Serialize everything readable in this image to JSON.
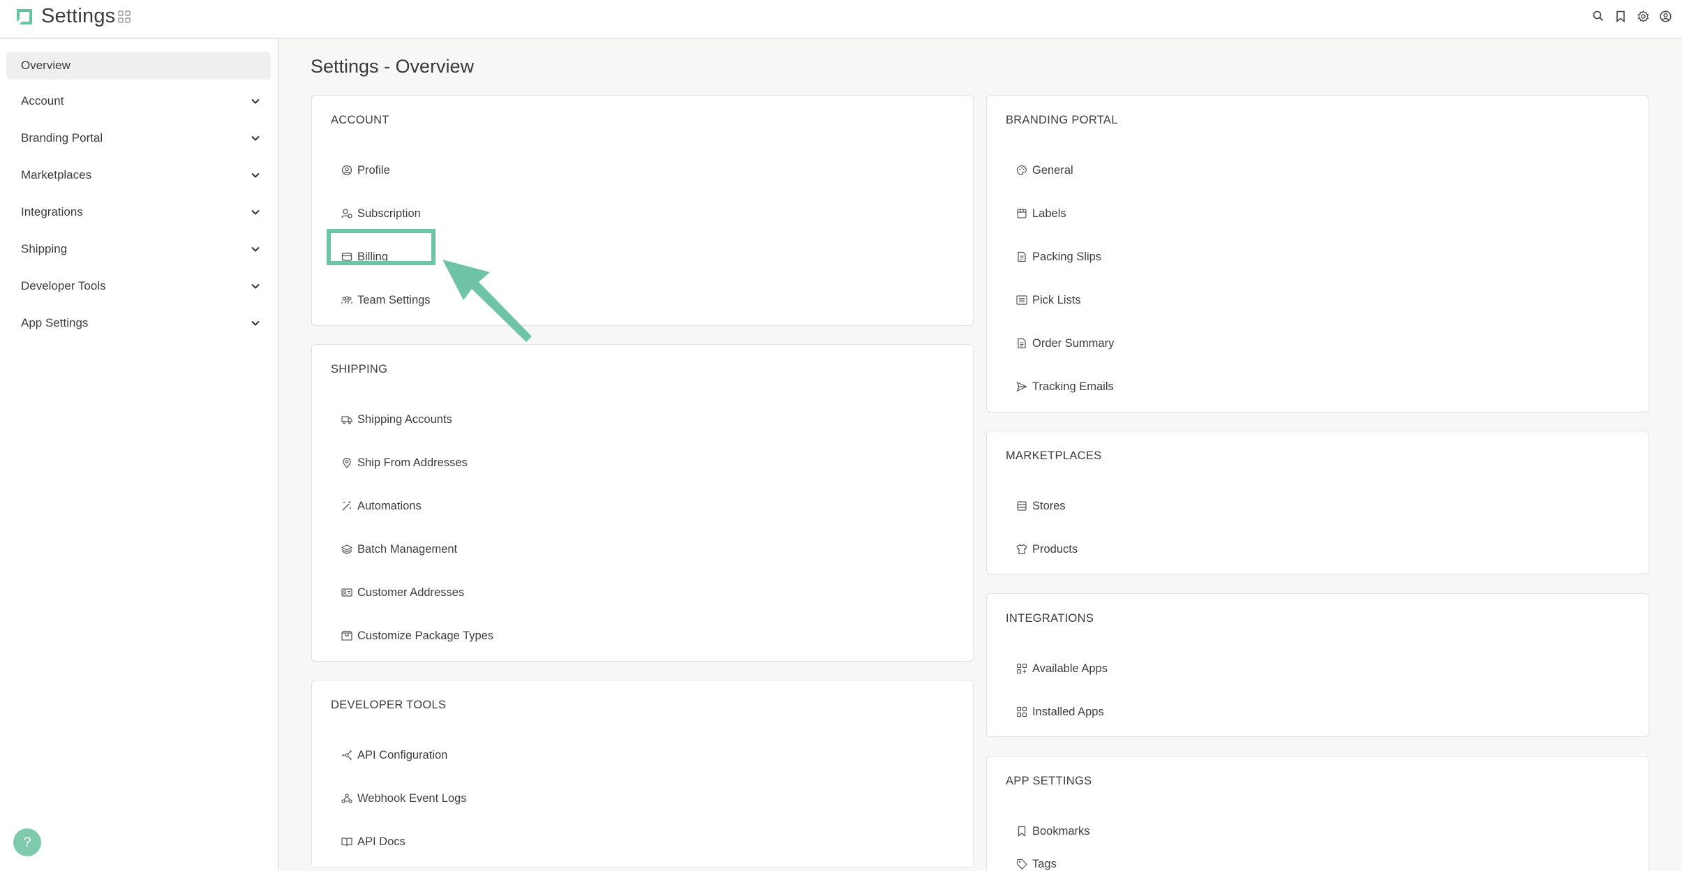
{
  "app": {
    "title": "Settings"
  },
  "header": {
    "icons": [
      "search-icon",
      "bookmark-icon",
      "gear-icon",
      "user-icon"
    ]
  },
  "sidebar": {
    "items": [
      {
        "label": "Overview",
        "active": true
      },
      {
        "label": "Account"
      },
      {
        "label": "Branding Portal"
      },
      {
        "label": "Marketplaces"
      },
      {
        "label": "Integrations"
      },
      {
        "label": "Shipping"
      },
      {
        "label": "Developer Tools"
      },
      {
        "label": "App Settings"
      }
    ]
  },
  "main": {
    "title": "Settings - Overview",
    "cards": {
      "account": {
        "title": "ACCOUNT",
        "links": [
          "Profile",
          "Subscription",
          "Billing",
          "Team Settings"
        ]
      },
      "shipping": {
        "title": "SHIPPING",
        "links": [
          "Shipping Accounts",
          "Ship From Addresses",
          "Automations",
          "Batch Management",
          "Customer Addresses",
          "Customize Package Types"
        ]
      },
      "developer": {
        "title": "DEVELOPER TOOLS",
        "links": [
          "API Configuration",
          "Webhook Event Logs",
          "API Docs"
        ]
      },
      "branding": {
        "title": "BRANDING PORTAL",
        "links": [
          "General",
          "Labels",
          "Packing Slips",
          "Pick Lists",
          "Order Summary",
          "Tracking Emails"
        ]
      },
      "marketplaces": {
        "title": "MARKETPLACES",
        "links": [
          "Stores",
          "Products"
        ]
      },
      "integrations": {
        "title": "INTEGRATIONS",
        "links": [
          "Available Apps",
          "Installed Apps"
        ]
      },
      "app_settings": {
        "title": "APP SETTINGS",
        "links": [
          "Bookmarks",
          "Tags"
        ]
      }
    }
  },
  "help": {
    "label": "?"
  },
  "colors": {
    "accent": "#6fc4a5",
    "brand": "#5fbfa0"
  }
}
